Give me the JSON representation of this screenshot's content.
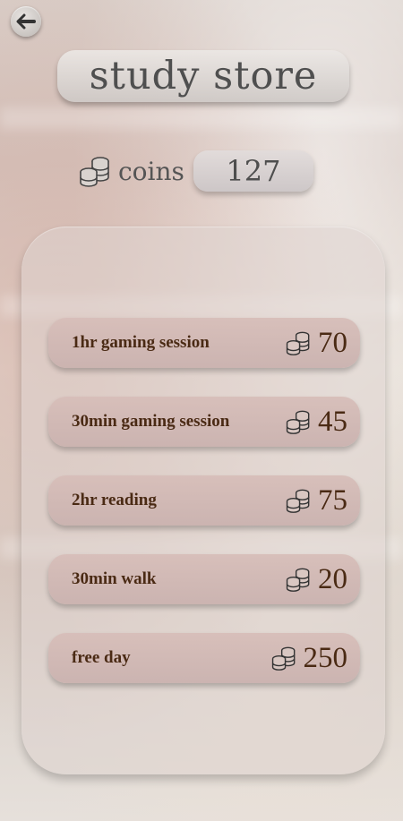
{
  "header": {
    "title": "study store",
    "back_icon": "arrow-left-icon"
  },
  "wallet": {
    "label": "coins",
    "value": "127",
    "icon": "coin-stack-icon"
  },
  "store_items": [
    {
      "label": "1hr gaming session",
      "price": "70"
    },
    {
      "label": "30min gaming session",
      "price": "45"
    },
    {
      "label": "2hr reading",
      "price": "75"
    },
    {
      "label": "30min walk",
      "price": "20"
    },
    {
      "label": "free day",
      "price": "250"
    }
  ],
  "colors": {
    "item_text": "#4a2a14",
    "title_text": "#4f4f4f"
  }
}
